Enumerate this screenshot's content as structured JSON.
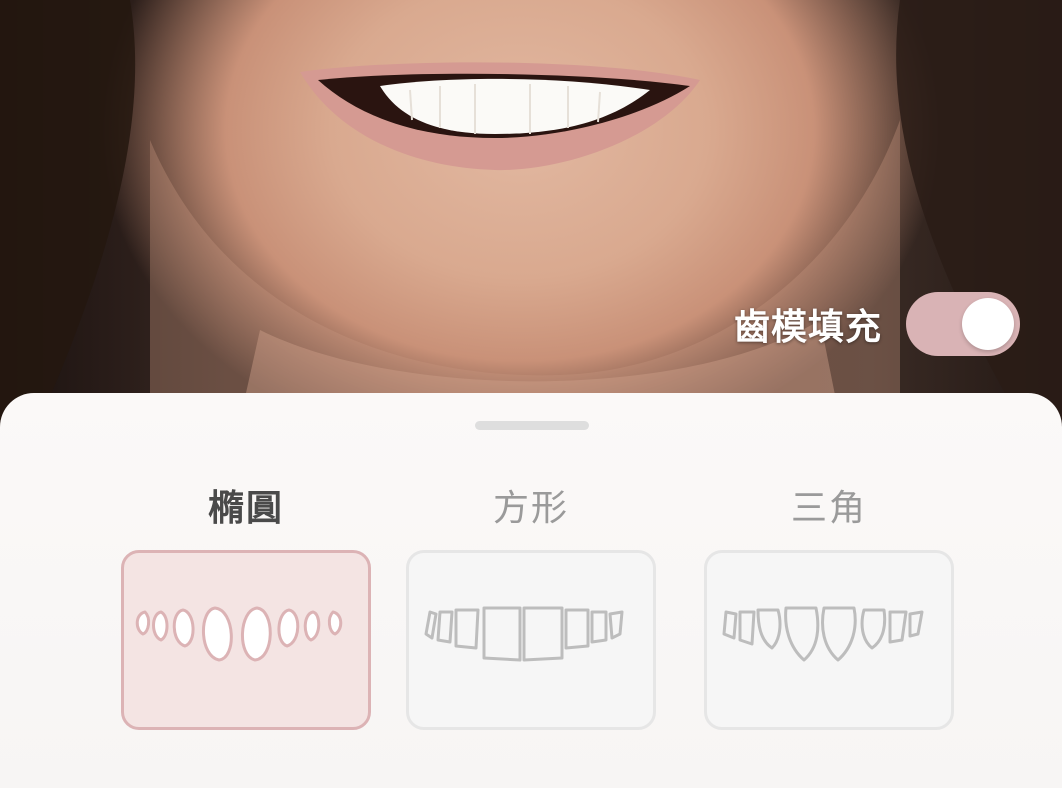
{
  "overlay": {
    "toggle_label": "齒模填充",
    "toggle_on": true
  },
  "sheet": {
    "options": [
      {
        "label": "橢圓",
        "selected": true
      },
      {
        "label": "方形",
        "selected": false
      },
      {
        "label": "三角",
        "selected": false
      }
    ]
  },
  "colors": {
    "accent": "#d9b3b5",
    "selected_card_bg": "#f4e4e3",
    "selected_card_border": "#dcb3b5",
    "card_border": "#e6e6e6"
  }
}
